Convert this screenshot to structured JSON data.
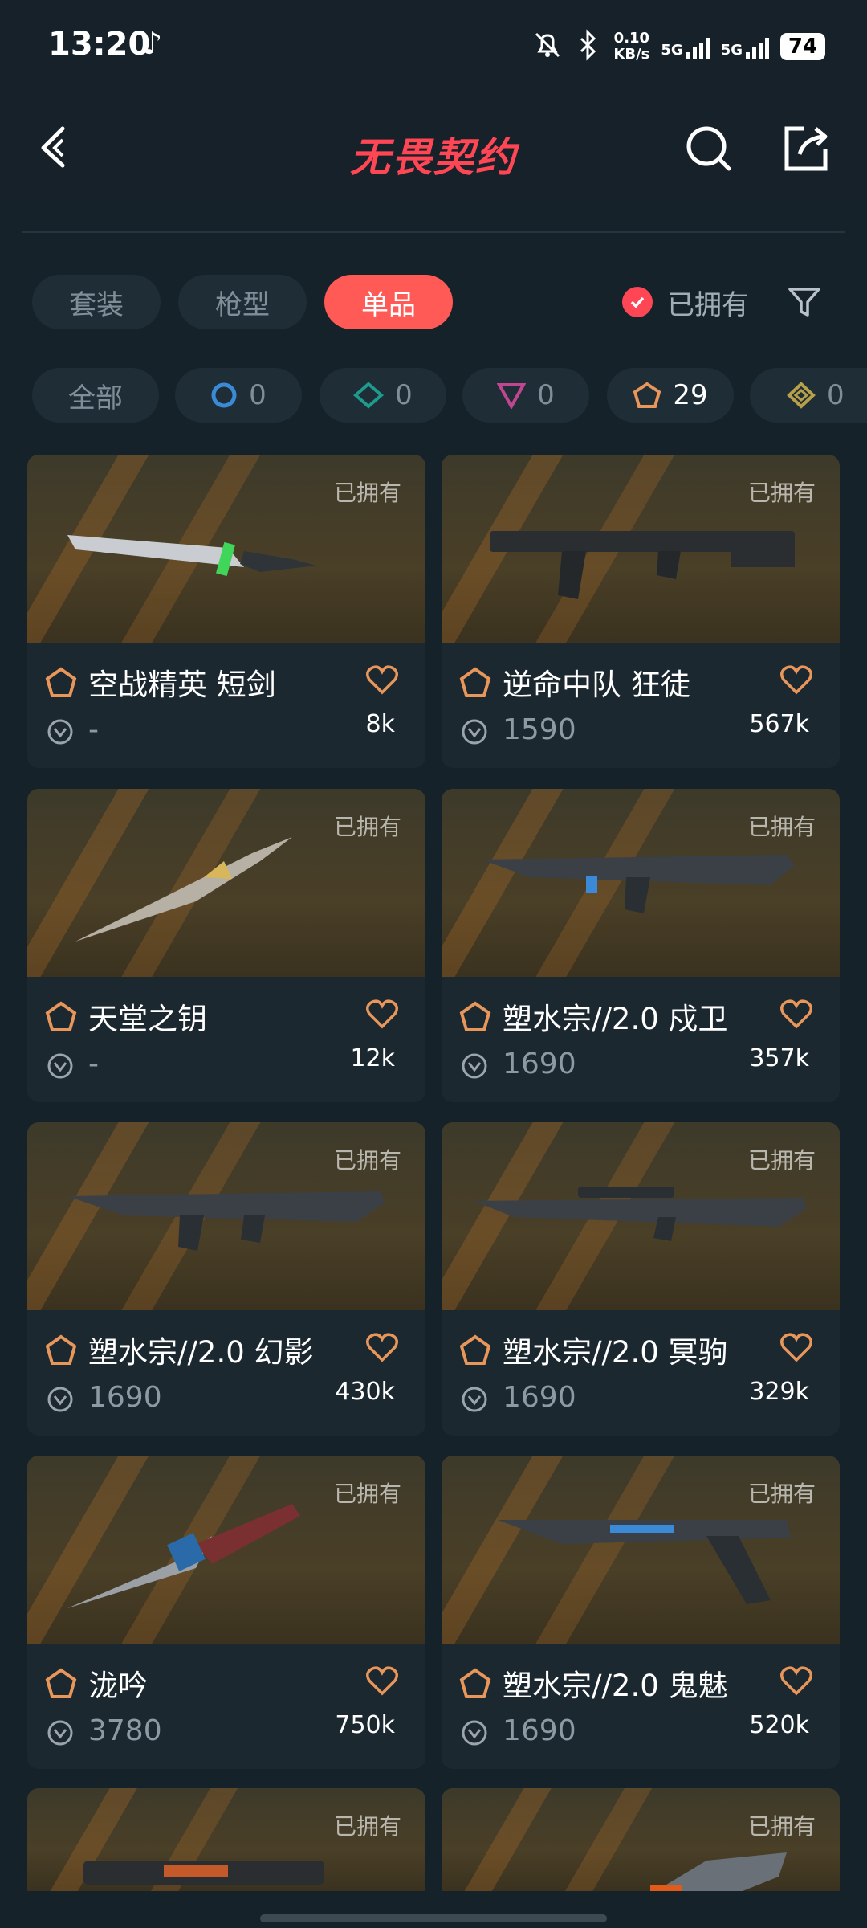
{
  "status": {
    "time": "13:20",
    "net_speed": "0.10",
    "net_unit": "KB/s",
    "sim1": "5G",
    "sim2": "5G",
    "battery": "74"
  },
  "header": {
    "title": "无畏契约"
  },
  "tabs": [
    {
      "label": "套装"
    },
    {
      "label": "枪型"
    },
    {
      "label": "单品"
    }
  ],
  "owned_filter": {
    "label": "已拥有"
  },
  "chips": [
    {
      "label": "全部",
      "count": ""
    },
    {
      "label": "",
      "count": "0",
      "icon": "select-tier-icon"
    },
    {
      "label": "",
      "count": "0",
      "icon": "deluxe-tier-icon"
    },
    {
      "label": "",
      "count": "0",
      "icon": "premium-tier-icon"
    },
    {
      "label": "",
      "count": "29",
      "icon": "exclusive-tier-icon"
    },
    {
      "label": "",
      "count": "0",
      "icon": "ultra-tier-icon"
    }
  ],
  "items": [
    {
      "owned": "已拥有",
      "name": "空战精英 短剑",
      "price": "-",
      "likes": "8k"
    },
    {
      "owned": "已拥有",
      "name": "逆命中队 狂徒",
      "price": "1590",
      "likes": "567k"
    },
    {
      "owned": "已拥有",
      "name": "天堂之钥",
      "price": "-",
      "likes": "12k"
    },
    {
      "owned": "已拥有",
      "name": "塑水宗//2.0 戍卫",
      "price": "1690",
      "likes": "357k"
    },
    {
      "owned": "已拥有",
      "name": "塑水宗//2.0 幻影",
      "price": "1690",
      "likes": "430k"
    },
    {
      "owned": "已拥有",
      "name": "塑水宗//2.0 冥驹",
      "price": "1690",
      "likes": "329k"
    },
    {
      "owned": "已拥有",
      "name": "泷吟",
      "price": "3780",
      "likes": "750k"
    },
    {
      "owned": "已拥有",
      "name": "塑水宗//2.0 鬼魅",
      "price": "1690",
      "likes": "520k"
    },
    {
      "owned": "已拥有",
      "name": "",
      "price": "",
      "likes": ""
    },
    {
      "owned": "已拥有",
      "name": "",
      "price": "",
      "likes": ""
    }
  ],
  "colors": {
    "accent": "#ff5a55",
    "exclusive": "#e8965a",
    "background": "#16222a"
  }
}
